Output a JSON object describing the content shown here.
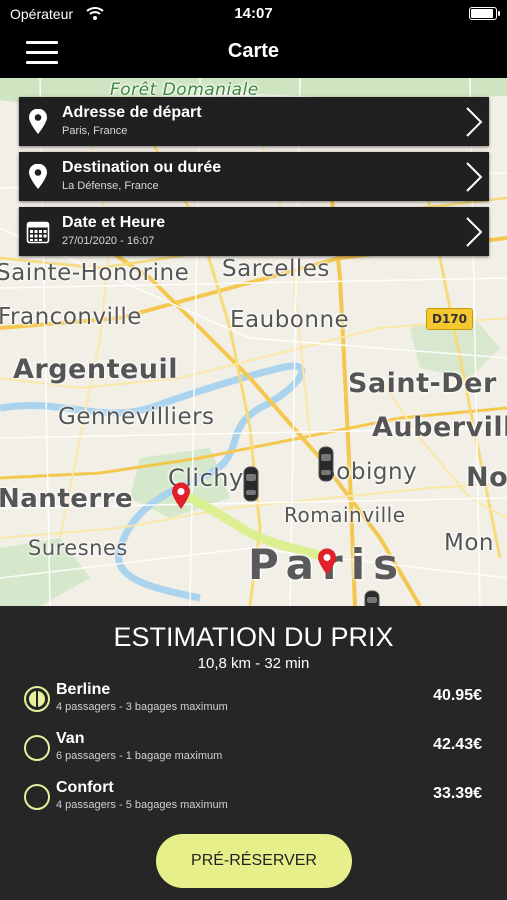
{
  "status_bar": {
    "carrier": "Opérateur",
    "time": "14:07"
  },
  "nav": {
    "title": "Carte"
  },
  "map": {
    "places": {
      "foret": "Forêt Domaniale",
      "sainte_honorine": "Sainte-Honorine",
      "sarcelles": "Sarcelles",
      "franconville": "Franconville",
      "eaubonne": "Eaubonne",
      "argenteuil": "Argenteuil",
      "saint_denis": "Saint-Der",
      "gennevilliers": "Gennevilliers",
      "aubervilliers": "Auberville",
      "clichy": "Clichy",
      "bobigny": "Bobigny",
      "noisy": "No",
      "nanterre": "Nanterre",
      "romainville": "Romainville",
      "suresnes": "Suresnes",
      "montreuil": "Mon",
      "paris": "Paris"
    },
    "road_badge": "D170"
  },
  "route": {
    "departure": {
      "label": "Adresse de départ",
      "value": "Paris, France"
    },
    "destination": {
      "label": "Destination ou durée",
      "value": "La Défense, France"
    },
    "datetime": {
      "label": "Date et Heure",
      "value": "27/01/2020 - 16:07"
    }
  },
  "estimate": {
    "heading": "ESTIMATION DU PRIX",
    "distance": "10,8 km - 32 min",
    "options": [
      {
        "name": "Berline",
        "desc": "4 passagers - 3 bagages maximum",
        "price": "40.95€",
        "selected": true
      },
      {
        "name": "Van",
        "desc": "6 passagers - 1 bagage maximum",
        "price": "42.43€",
        "selected": false
      },
      {
        "name": "Confort",
        "desc": "4 passagers - 5 bagages maximum",
        "price": "33.39€",
        "selected": false
      }
    ],
    "cta": "PRÉ-RÉSERVER"
  },
  "colors": {
    "accent": "#e6ef8a",
    "panel": "#262626",
    "pin": "#e0202a",
    "route": "#d9ef8a"
  },
  "icons": [
    "wifi-icon",
    "battery-icon",
    "hamburger-menu-icon",
    "location-pin-icon",
    "calendar-icon",
    "chevron-right-icon",
    "car-icon",
    "map-marker-icon",
    "radio-button-icon"
  ]
}
